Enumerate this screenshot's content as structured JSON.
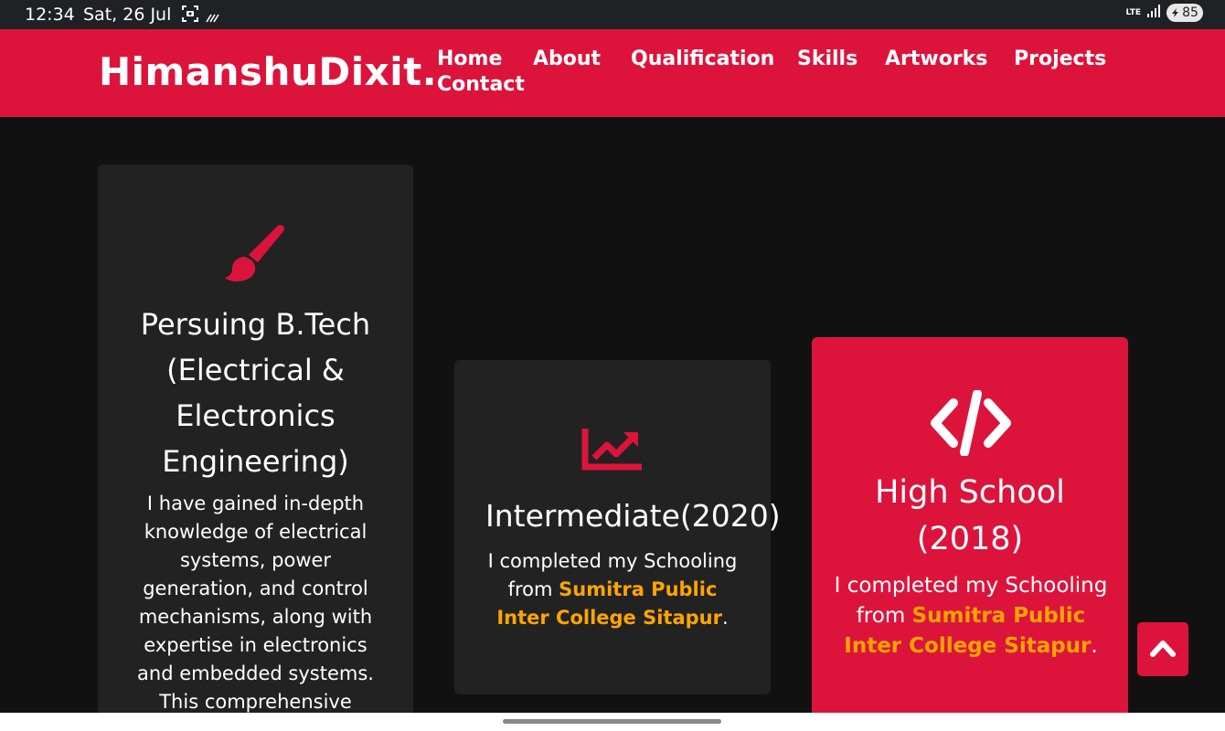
{
  "status_bar": {
    "time": "12:34",
    "date": "Sat, 26 Jul",
    "network": "LTE",
    "battery": "85",
    "icons": [
      "screenshot-icon",
      "stripes-icon",
      "signal-icon",
      "battery-icon"
    ]
  },
  "navbar": {
    "brand": "HimanshuDixit.",
    "links": [
      "Home",
      "About",
      "Qualification",
      "Skills",
      "Artworks",
      "Projects",
      "Contact"
    ],
    "background": "#dc143c"
  },
  "cards": [
    {
      "icon": "paint-brush-icon",
      "title_lines": [
        "Persuing B.Tech",
        "(Electrical &",
        "Electronics",
        "Engineering)"
      ],
      "text_lines": [
        "I have gained in-depth",
        "knowledge of electrical",
        "systems, power",
        "generation, and control",
        "mechanisms, along with",
        "expertise in electronics",
        "and embedded systems.",
        "This comprehensive"
      ]
    },
    {
      "icon": "chart-line-icon",
      "title": "Intermediate(2020)",
      "text_before": "I completed my Schooling from ",
      "highlight": "Sumitra Public Inter College Sitapur",
      "text_after": "."
    },
    {
      "icon": "code-icon",
      "title_lines": [
        "High School",
        "(2018)"
      ],
      "text_before": "I completed my Schooling from ",
      "highlight": "Sumitra Public Inter College Sitapur",
      "text_after": "."
    }
  ],
  "colors": {
    "accent": "#dc143c",
    "highlight": "#ffa500",
    "card_dark": "#222222",
    "page": "#111111"
  },
  "scroll_top": {
    "icon": "chevron-up-icon"
  }
}
